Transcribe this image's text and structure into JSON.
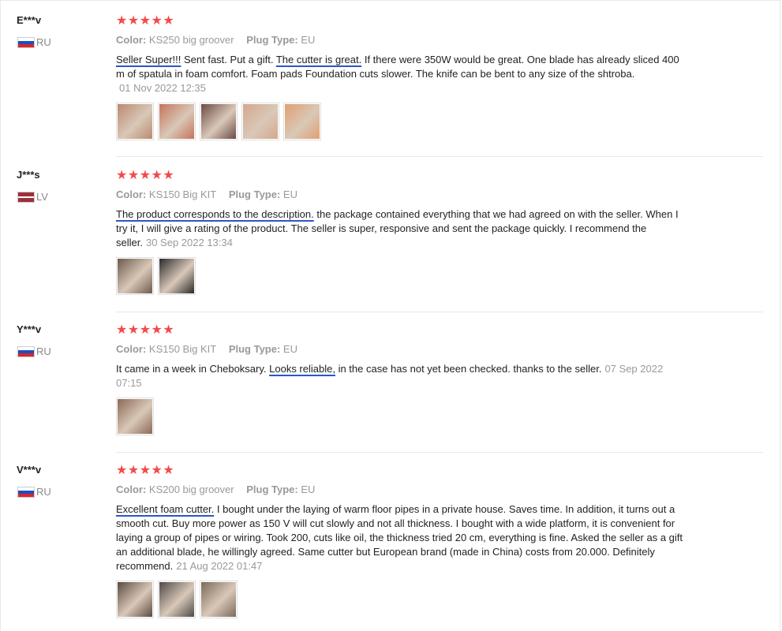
{
  "reviews": [
    {
      "user": "E***v",
      "country": "RU",
      "stars": "★★★★★",
      "color_label": "Color:",
      "color_value": "KS250 big groover",
      "plug_label": "Plug Type:",
      "plug_value": "EU",
      "text": {
        "u1": "Seller Super!!!",
        "p1": " Sent fast. Put a gift. ",
        "u2": "The cutter is great.",
        "p2": " If there were 350W would be great. One blade has already sliced 400 m of spatula in foam comfort. Foam pads Foundation cuts slower. The knife can be bent to any size of the shtroba."
      },
      "date": "01 Nov 2022 12:35",
      "thumb_colors": [
        "#b98a6f",
        "#c4745a",
        "#6b4a44",
        "#d4a78e",
        "#e0a070"
      ]
    },
    {
      "user": "J***s",
      "country": "LV",
      "stars": "★★★★★",
      "color_label": "Color:",
      "color_value": "KS150 Big KIT",
      "plug_label": "Plug Type:",
      "plug_value": "EU",
      "text": {
        "u1": "The product corresponds to the description.",
        "p1": " the package contained everything that we had agreed on with the seller. When I try it, I will give a rating of the product. The seller is super, responsive and sent the package quickly. I recommend the seller."
      },
      "date": "30 Sep 2022 13:34",
      "thumb_colors": [
        "#6e5a4c",
        "#2a2a2a"
      ]
    },
    {
      "user": "Y***v",
      "country": "RU",
      "stars": "★★★★★",
      "color_label": "Color:",
      "color_value": "KS150 Big KIT",
      "plug_label": "Plug Type:",
      "plug_value": "EU",
      "text": {
        "p0": "It came in a week in Cheboksary. ",
        "u1": "Looks reliable,",
        "p1": " in the case has not yet been checked. thanks to the seller."
      },
      "date": "07 Sep 2022 07:15",
      "thumb_colors": [
        "#8a6a55"
      ]
    },
    {
      "user": "V***v",
      "country": "RU",
      "stars": "★★★★★",
      "color_label": "Color:",
      "color_value": "KS200 big groover",
      "plug_label": "Plug Type:",
      "plug_value": "EU",
      "text": {
        "u1": "Excellent foam cutter.",
        "p1": " I bought under the laying of warm floor pipes in a private house. Saves time. In addition, it turns out a smooth cut. Buy more power as 150 V will cut slowly and not all thickness. I bought with a wide platform, it is convenient for laying a group of pipes or wiring. Took 200, cuts like oil, the thickness tried 20 cm, everything is fine. Asked the seller as a gift an additional blade, he willingly agreed. Same cutter but European brand (made in China) costs from 20.000. Definitely recommend."
      },
      "date": "21 Aug 2022 01:47",
      "thumb_colors": [
        "#5a4a40",
        "#4e4a48",
        "#7a6a58"
      ]
    }
  ]
}
